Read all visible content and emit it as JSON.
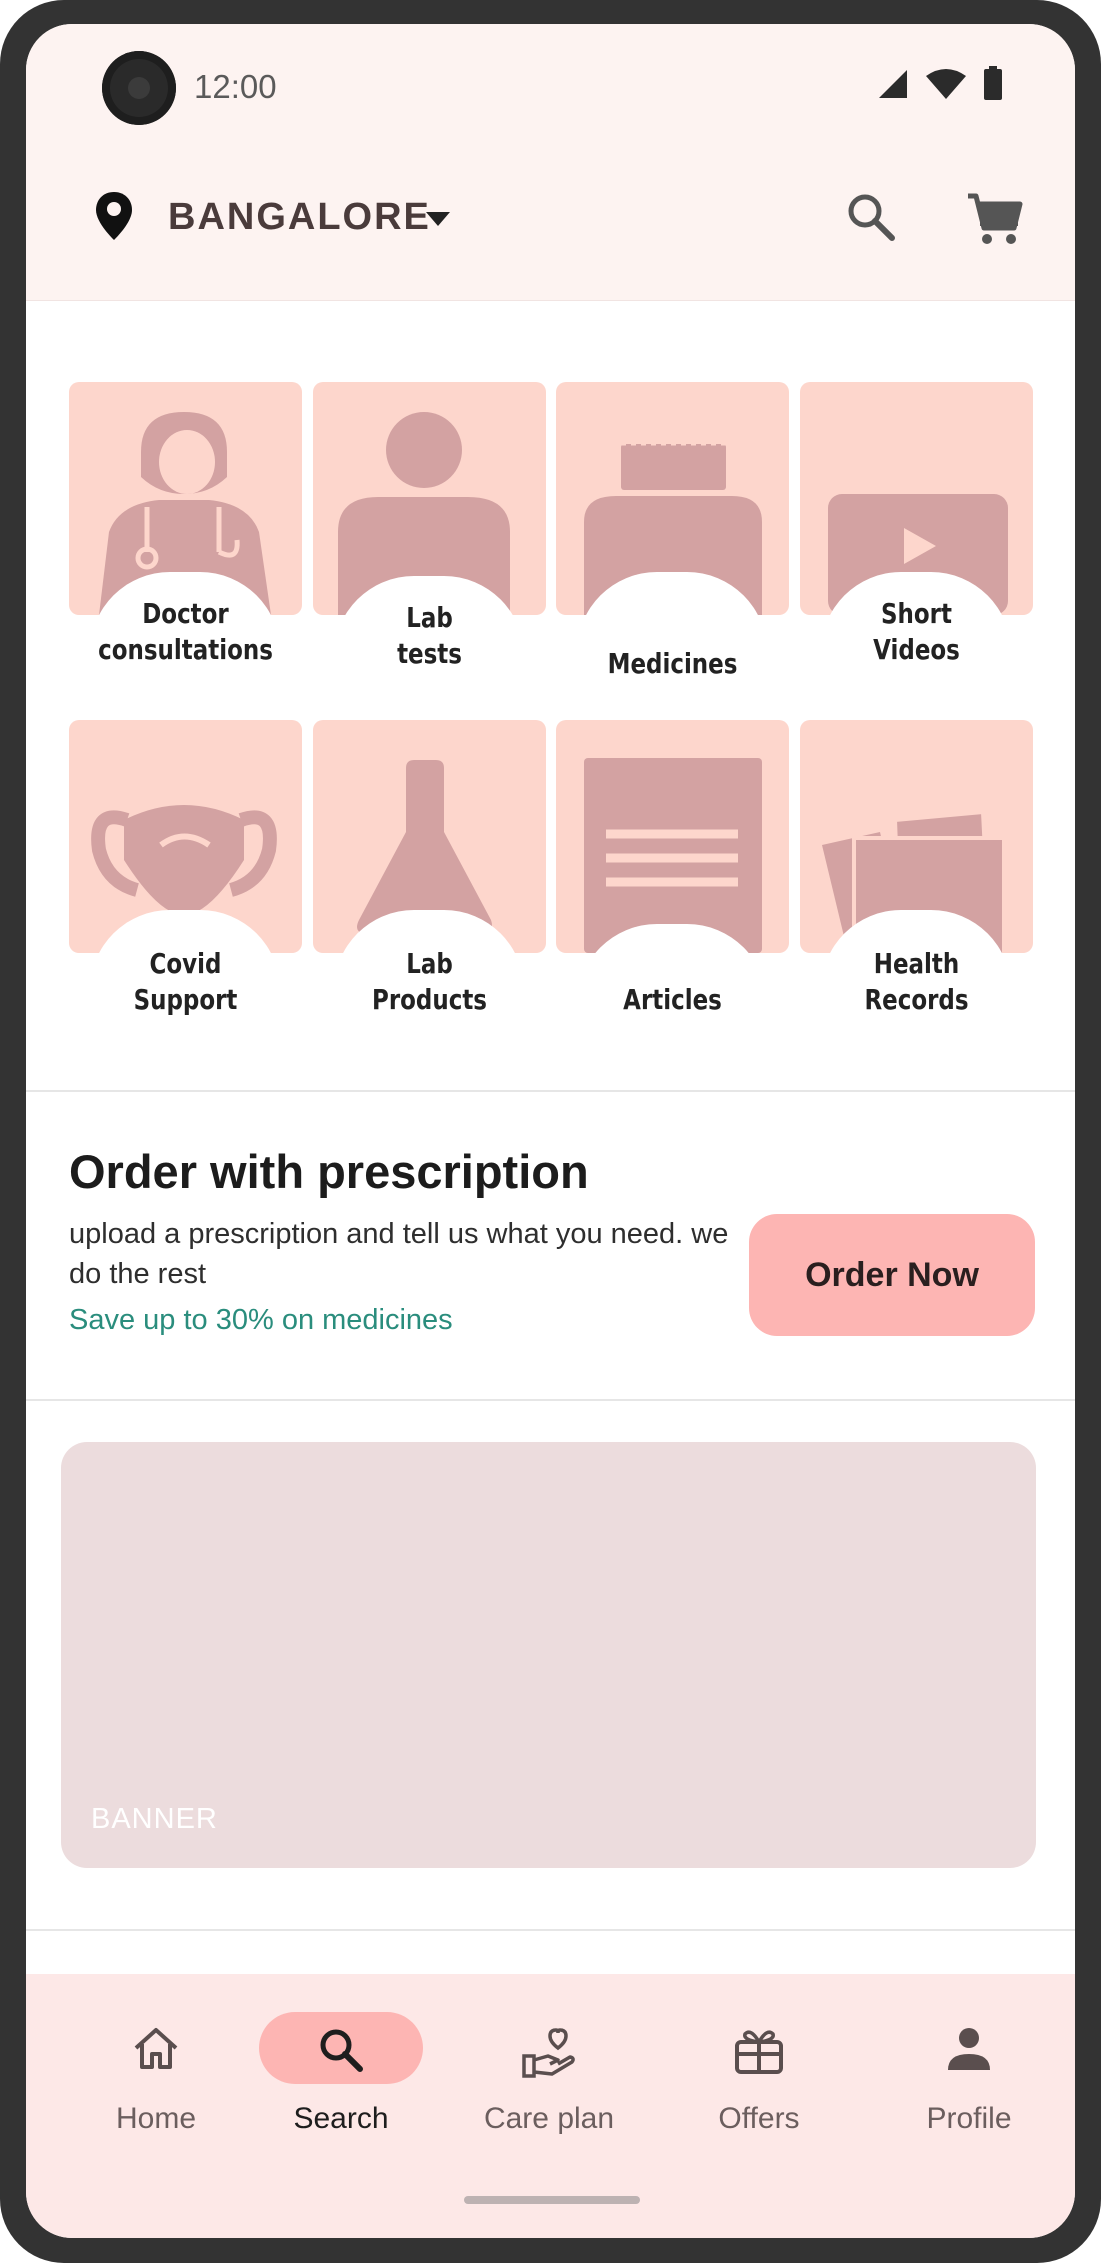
{
  "status_bar": {
    "time": "12:00"
  },
  "header": {
    "location": "BANGALORE"
  },
  "categories": [
    {
      "label": "Doctor consultations",
      "line1": "Doctor",
      "line2": "consultations",
      "icon": "doctor-icon"
    },
    {
      "label": "Lab tests",
      "line1": "Lab",
      "line2": "tests",
      "icon": "person-icon"
    },
    {
      "label": "Medicines",
      "line1": "Medicines",
      "line2": "",
      "icon": "medicine-bottle-icon"
    },
    {
      "label": "Short Videos",
      "line1": "Short",
      "line2": "Videos",
      "icon": "video-play-icon"
    },
    {
      "label": "Covid Support",
      "line1": "Covid",
      "line2": "Support",
      "icon": "face-mask-icon"
    },
    {
      "label": "Lab Products",
      "line1": "Lab",
      "line2": "Products",
      "icon": "flask-icon"
    },
    {
      "label": "Articles",
      "line1": "Articles",
      "line2": "",
      "icon": "document-icon"
    },
    {
      "label": "Health Records",
      "line1": "Health",
      "line2": "Records",
      "icon": "records-stack-icon"
    }
  ],
  "order": {
    "title": "Order with prescription",
    "description": "upload a prescription and tell us what you need. we do the rest",
    "savings": "Save up to 30% on medicines",
    "button": "Order Now"
  },
  "banner": {
    "label": "BANNER"
  },
  "bottom_nav": {
    "active": "Search",
    "items": [
      {
        "label": "Home",
        "icon": "home-icon"
      },
      {
        "label": "Search",
        "icon": "search-icon"
      },
      {
        "label": "Care plan",
        "icon": "care-plan-icon"
      },
      {
        "label": "Offers",
        "icon": "gift-icon"
      },
      {
        "label": "Profile",
        "icon": "profile-icon"
      }
    ]
  },
  "colors": {
    "tile_bg": "#fdd6cc",
    "tile_icon": "#d3a2a2",
    "accent_button": "#fdb5b3",
    "savings_text": "#2a8d7d",
    "banner_bg": "#ecdcdd",
    "nav_bg": "#fde8e7"
  }
}
